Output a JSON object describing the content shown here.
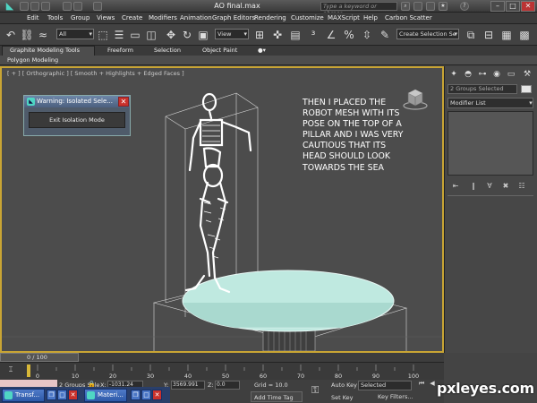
{
  "titlebar": {
    "title": "AO final.max",
    "search_placeholder": "Type a keyword or phrase"
  },
  "menu": [
    "Edit",
    "Tools",
    "Group",
    "Views",
    "Create",
    "Modifiers",
    "Animation",
    "Graph Editors",
    "Rendering",
    "Customize",
    "MAXScript",
    "Help",
    "Carbon Scatter"
  ],
  "toolbar": {
    "filter_value": "All",
    "view_value": "View",
    "selection_set_placeholder": "Create Selection Se"
  },
  "ribbon": {
    "tabs": [
      "Graphite Modeling Tools",
      "Freeform",
      "Selection",
      "Object Paint"
    ],
    "active_subtab": "Polygon Modeling"
  },
  "viewport": {
    "label": "[ + ] [ Orthographic ] [ Smooth + Highlights + Edged Faces ]",
    "caption": "THEN I PLACED THE ROBOT MESH WITH ITS POSE ON THE TOP OF A PILLAR AND I WAS VERY CAUTIOUS THAT ITS HEAD SHOULD LOOK TOWARDS THE SEA",
    "colors": {
      "border": "#c9a534",
      "background": "#4c4c4c",
      "pillar_top": "#bfe9e0",
      "mesh": "#ffffff"
    }
  },
  "isolation_dialog": {
    "title": "Warning: Isolated Sele...",
    "button_label": "Exit Isolation Mode"
  },
  "command_panel": {
    "name_field": "2 Groups Selected",
    "modifier_list": "Modifier List"
  },
  "timeline": {
    "frame_label": "0 / 100",
    "ticks": [
      "0",
      "10",
      "20",
      "30",
      "40",
      "50",
      "60",
      "70",
      "80",
      "90",
      "100"
    ]
  },
  "status": {
    "selection": "2 Groups Sele",
    "x_label": "X:",
    "x_value": "-1031.24",
    "y_label": "Y:",
    "y_value": "3569.991",
    "z_label": "Z:",
    "z_value": "0.0",
    "grid": "Grid = 10.0",
    "add_time_tag": "Add Time Tag",
    "auto_key": "Auto Key",
    "set_key": "Set Key",
    "key_mode": "Selected",
    "key_filters": "Key Filters..."
  },
  "taskbar": {
    "items": [
      "Transf...",
      "Materi..."
    ]
  },
  "watermark": "pxleyes.com"
}
